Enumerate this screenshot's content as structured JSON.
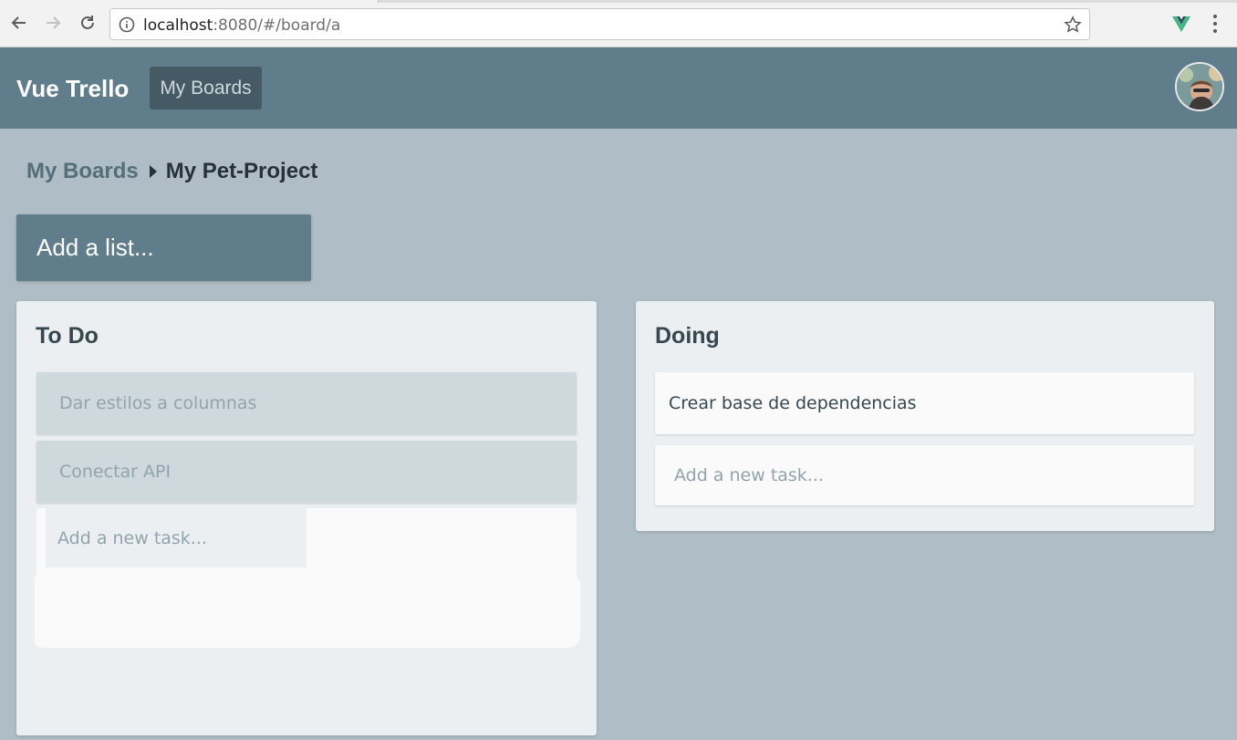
{
  "browser": {
    "url_host": "localhost",
    "url_rest": ":8080/#/board/a"
  },
  "header": {
    "brand": "Vue Trello",
    "nav_label": "My Boards"
  },
  "breadcrumb": {
    "parent": "My Boards",
    "current": "My Pet-Project"
  },
  "add_list_label": "Add a list...",
  "lists": [
    {
      "title": "To Do",
      "cards": [
        "Dar estilos a columnas",
        "Conectar API"
      ],
      "new_task_placeholder": "Add a new task..."
    },
    {
      "title": "Doing",
      "cards": [
        "Crear base de dependencias"
      ],
      "new_task_placeholder": "Add a new task..."
    }
  ],
  "colors": {
    "header": "#607d8b",
    "nav_active": "#455a64",
    "background": "#afbec6",
    "list": "#eceff1",
    "card_done": "#cfd8dc"
  }
}
